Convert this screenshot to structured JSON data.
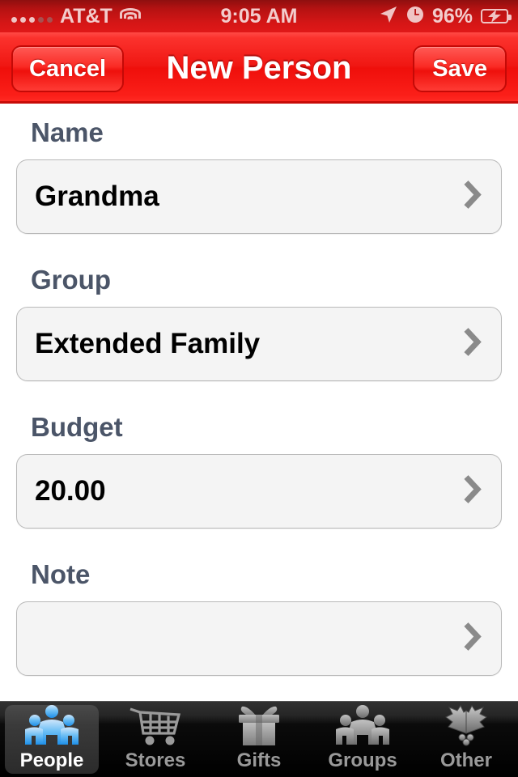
{
  "statusbar": {
    "signal_icon": "signal-bars-icon",
    "signal_bars_filled": 3,
    "signal_bars_total": 5,
    "carrier": "AT&T",
    "wifi_icon": "wifi-icon",
    "time": "9:05 AM",
    "location_icon": "location-arrow-icon",
    "alarm_icon": "alarm-clock-icon",
    "battery_percent": "96%",
    "battery_icon": "battery-charging-icon"
  },
  "navbar": {
    "cancel_label": "Cancel",
    "title": "New Person",
    "save_label": "Save",
    "accent_color": "#ef1410"
  },
  "form": {
    "fields": [
      {
        "label": "Name",
        "value": "Grandma",
        "placeholder": "",
        "chevron_icon": "chevron-right-icon"
      },
      {
        "label": "Group",
        "value": "Extended Family",
        "placeholder": "",
        "chevron_icon": "chevron-right-icon"
      },
      {
        "label": "Budget",
        "value": "20.00",
        "placeholder": "",
        "chevron_icon": "chevron-right-icon"
      },
      {
        "label": "Note",
        "value": "",
        "placeholder": "",
        "chevron_icon": "chevron-right-icon"
      }
    ],
    "label_color": "#4b5568",
    "field_bg": "#f4f4f4"
  },
  "tabbar": {
    "selected_index": 0,
    "selected_color": "#4aa8f0",
    "items": [
      {
        "label": "People",
        "icon": "people-group-icon"
      },
      {
        "label": "Stores",
        "icon": "shopping-cart-icon"
      },
      {
        "label": "Gifts",
        "icon": "gift-box-icon"
      },
      {
        "label": "Groups",
        "icon": "people-group-icon"
      },
      {
        "label": "Other",
        "icon": "holly-leaves-icon"
      }
    ]
  }
}
